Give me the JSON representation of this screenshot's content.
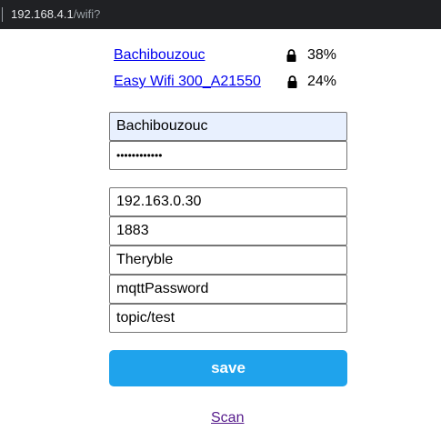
{
  "browser": {
    "url_host": "192.168.4.1",
    "url_path": "/wifi?"
  },
  "networks": [
    {
      "ssid": "Bachibouzouc",
      "locked": true,
      "quality": "38%"
    },
    {
      "ssid": "Easy Wifi 300_A21550",
      "locked": true,
      "quality": "24%"
    }
  ],
  "wifi_form": {
    "ssid_value": "Bachibouzouc",
    "password_mask": "••••••••••••"
  },
  "mqtt_form": {
    "server": "192.163.0.30",
    "port": "1883",
    "user": "Theryble",
    "password": "mqttPassword",
    "topic": "topic/test"
  },
  "actions": {
    "save_label": "save",
    "scan_label": "Scan"
  },
  "icons": {
    "lock": "lock-icon"
  },
  "colors": {
    "save_button": "#1fa3ec",
    "link": "#0000ee",
    "visited_link": "#551a8b",
    "autofill_bg": "#e8f0fe"
  }
}
